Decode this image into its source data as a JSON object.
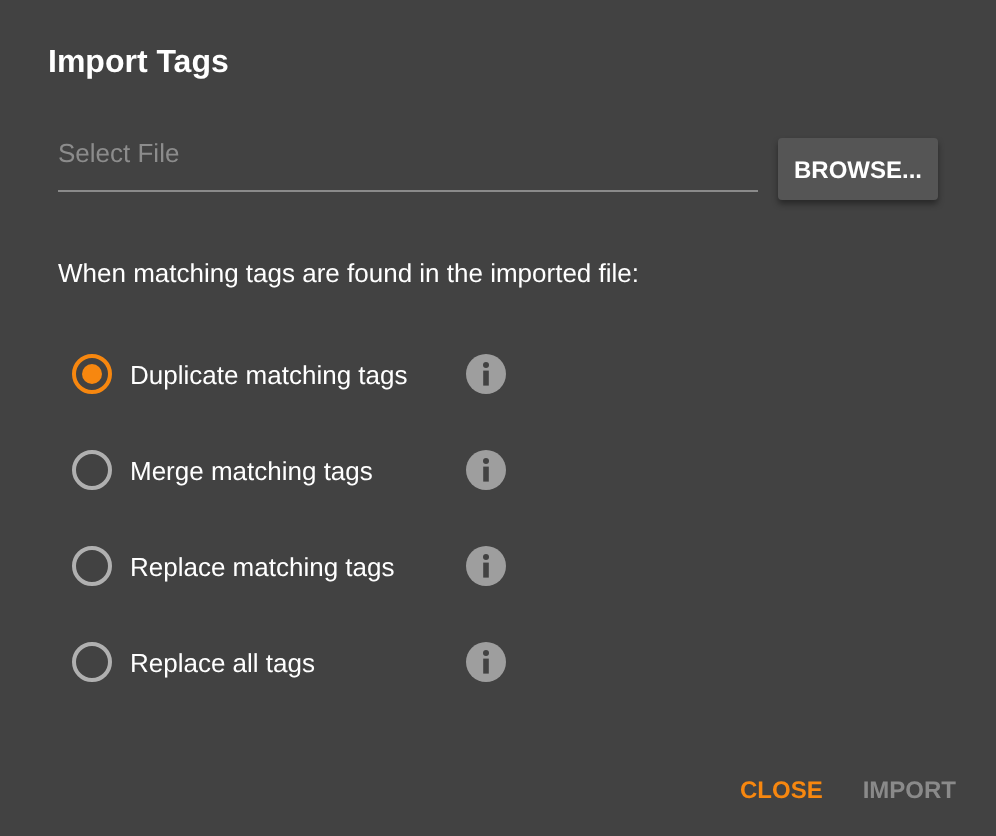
{
  "dialog": {
    "title": "Import Tags"
  },
  "file_field": {
    "placeholder": "Select File"
  },
  "browse_button": {
    "label": "BROWSE..."
  },
  "prompt": "When matching tags are found in the imported file:",
  "options": [
    {
      "label": "Duplicate matching tags",
      "selected": true
    },
    {
      "label": "Merge matching tags",
      "selected": false
    },
    {
      "label": "Replace matching tags",
      "selected": false
    },
    {
      "label": "Replace all tags",
      "selected": false
    }
  ],
  "actions": [
    {
      "label": "CLOSE",
      "disabled": false
    },
    {
      "label": "IMPORT",
      "disabled": true
    }
  ]
}
